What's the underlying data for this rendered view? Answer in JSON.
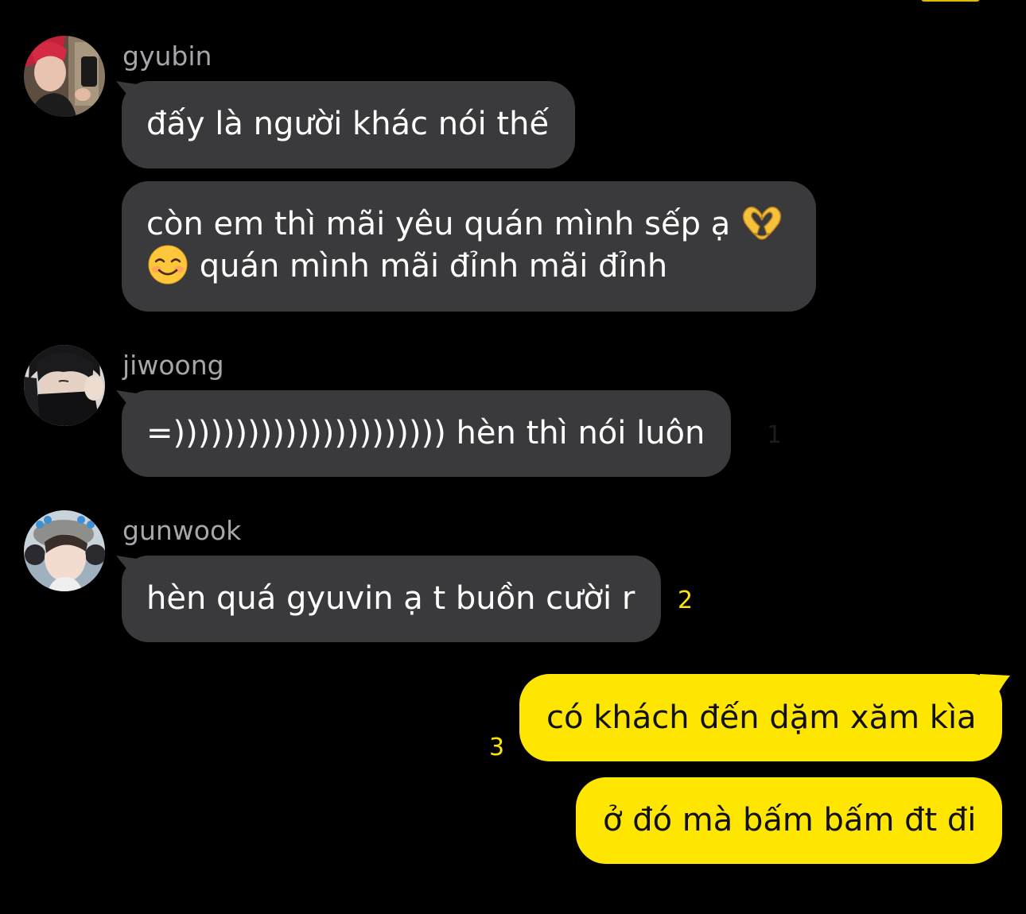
{
  "chat": {
    "messages": [
      {
        "sender": "gyubin",
        "text": "đấy là người khác nói thế"
      },
      {
        "sender": "gyubin",
        "line1": "còn em thì mãi yêu quán mình sếp ạ",
        "emoji1": "heart-hands-emoji",
        "emoji2": "smiling-face-emoji",
        "line2": "quán mình mãi đỉnh mãi đỉnh"
      },
      {
        "sender": "jiwoong",
        "text": "=)))))))))))))))))))))) hèn thì nói luôn",
        "unread": "1"
      },
      {
        "sender": "gunwook",
        "text": "hèn quá gyuvin ạ t buồn cười r",
        "unread": "2"
      },
      {
        "sender": "me",
        "text": "có khách đến dặm xăm kìa",
        "unread": "3"
      },
      {
        "sender": "me",
        "text": "ở đó mà bấm bấm đt đi"
      }
    ]
  },
  "colors": {
    "background": "#000000",
    "incoming_bubble": "#3a3a3c",
    "outgoing_bubble": "#ffe600",
    "unread_count": "#ffe600",
    "sender_name": "#a6a6ab"
  },
  "icons": {
    "avatar_gyubin": "profile-photo",
    "avatar_jiwoong": "profile-photo",
    "avatar_gunwook": "profile-photo"
  }
}
